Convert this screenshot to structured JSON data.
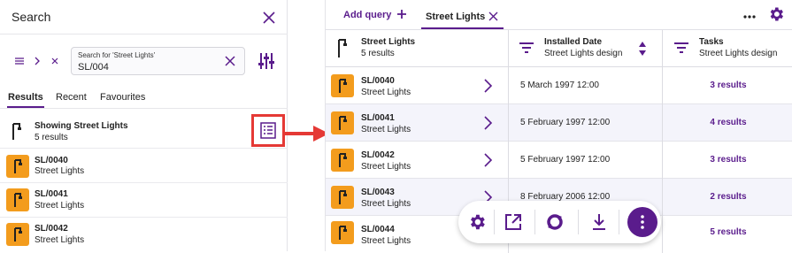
{
  "colors": {
    "accent": "#5a1c8c",
    "icon_bg": "#f39c1d",
    "highlight": "#e53935",
    "row_alt": "#f4f4fb"
  },
  "left_panel": {
    "title": "Search",
    "search": {
      "label": "Search for 'Street Lights'",
      "value": "SL/004"
    },
    "tabs": [
      "Results",
      "Recent",
      "Favourites"
    ],
    "showing": {
      "title": "Showing Street Lights",
      "count": "5 results"
    },
    "results": [
      {
        "id": "SL/0040",
        "type": "Street Lights"
      },
      {
        "id": "SL/0041",
        "type": "Street Lights"
      },
      {
        "id": "SL/0042",
        "type": "Street Lights"
      }
    ]
  },
  "right_panel": {
    "add_query": "Add query",
    "tab": "Street Lights",
    "columns": [
      {
        "title": "Street Lights",
        "sub": "5 results"
      },
      {
        "title": "Installed Date",
        "sub": "Street Lights design"
      },
      {
        "title": "Tasks",
        "sub": "Street Lights design"
      }
    ],
    "rows": [
      {
        "id": "SL/0040",
        "type": "Street Lights",
        "date": "5 March 1997 12:00",
        "tasks": "3 results"
      },
      {
        "id": "SL/0041",
        "type": "Street Lights",
        "date": "5 February 1997 12:00",
        "tasks": "4 results"
      },
      {
        "id": "SL/0042",
        "type": "Street Lights",
        "date": "5 February 1997 12:00",
        "tasks": "3 results"
      },
      {
        "id": "SL/0043",
        "type": "Street Lights",
        "date": "8 February 2006 12:00",
        "tasks": "2 results"
      },
      {
        "id": "SL/0044",
        "type": "Street Lights",
        "date": "",
        "tasks": "5 results"
      }
    ]
  },
  "icons": {
    "close": "close-icon",
    "tune": "tune-icon",
    "list": "list-view-icon",
    "street_light": "street-light-icon",
    "gear": "gear-icon",
    "more": "more-icon"
  }
}
